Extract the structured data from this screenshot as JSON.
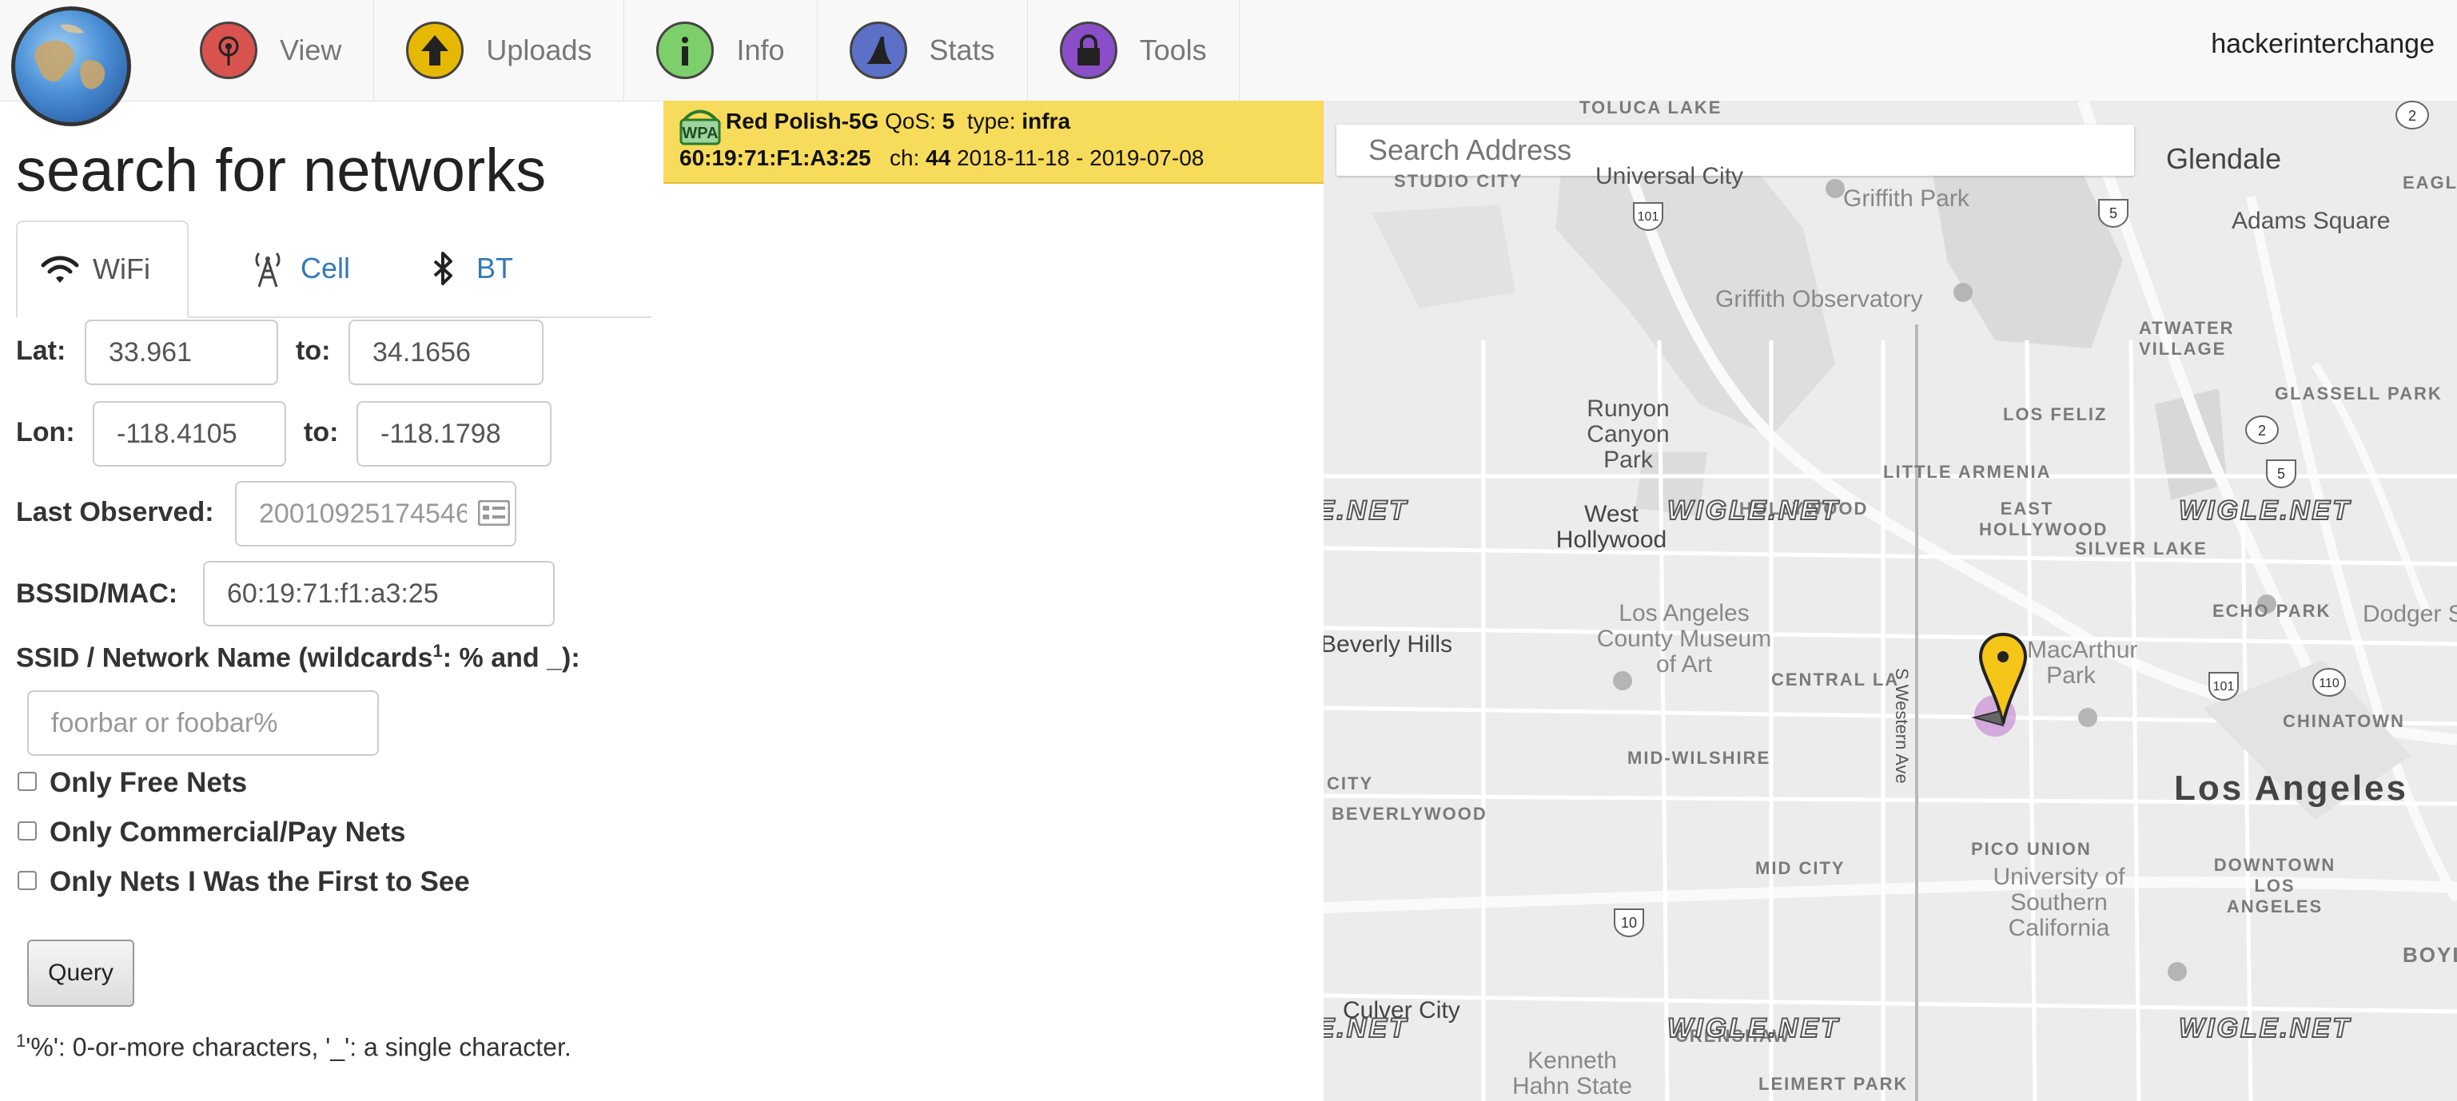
{
  "nav": {
    "items": [
      {
        "label": "View",
        "icon": "view-icon",
        "color": "#d9534f"
      },
      {
        "label": "Uploads",
        "icon": "upload-arrow-icon",
        "color": "#e6b800"
      },
      {
        "label": "Info",
        "icon": "info-icon",
        "color": "#5cb85c"
      },
      {
        "label": "Stats",
        "icon": "stats-icon",
        "color": "#4a5fb5"
      },
      {
        "label": "Tools",
        "icon": "lock-icon",
        "color": "#7b3fb5"
      }
    ],
    "username": "hackerinterchange"
  },
  "search": {
    "title": "search for networks",
    "tabs": [
      {
        "label": "WiFi",
        "icon": "wifi-icon",
        "active": true
      },
      {
        "label": "Cell",
        "icon": "cell-tower-icon",
        "active": false
      },
      {
        "label": "BT",
        "icon": "bluetooth-icon",
        "active": false
      }
    ],
    "lat_label": "Lat:",
    "lat_from": "33.961",
    "lat_to_label": "to:",
    "lat_to": "34.1656",
    "lon_label": "Lon:",
    "lon_from": "-118.4105",
    "lon_to_label": "to:",
    "lon_to": "-118.1798",
    "last_observed_label": "Last Observed:",
    "last_observed_placeholder": "20010925174546",
    "bssid_label": "BSSID/MAC:",
    "bssid_value": "60:19:71:f1:a3:25",
    "ssid_label_pre": "SSID / Network Name (wildcards",
    "ssid_label_sup": "1",
    "ssid_label_post": ": % and _):",
    "ssid_placeholder": "foorbar or foobar%",
    "checkboxes": [
      {
        "label": "Only Free Nets",
        "checked": false
      },
      {
        "label": "Only Commercial/Pay Nets",
        "checked": false
      },
      {
        "label": "Only Nets I Was the First to See",
        "checked": false
      }
    ],
    "query_label": "Query",
    "footnote_sup": "1",
    "footnote_text": "'%': 0-or-more characters, '_': a single character."
  },
  "result": {
    "icon": "wifi-infra-icon",
    "icon_text": "WPA",
    "ssid": "Red Polish-5G",
    "qos_label": "QoS:",
    "qos": "5",
    "type_label": "type:",
    "type": "infra",
    "bssid": "60:19:71:F1:A3:25",
    "channel_label": "ch:",
    "channel": "44",
    "dates": "2018-11-18 - 2019-07-08",
    "background": "#f7db5a"
  },
  "map": {
    "search_placeholder": "Search Address",
    "watermark": "WIGLE.NET",
    "marker_color": "#f5c518",
    "labels": {
      "toluca_lake": "TOLUCA LAKE",
      "glendale": "Glendale",
      "eagle": "EAGL",
      "studio_city": "STUDIO CITY",
      "universal_city": "Universal City",
      "griffith_park": "Griffith Park",
      "adams_square": "Adams Square",
      "griffith_observatory": "Griffith Observatory",
      "atwater_village": "ATWATER VILLAGE",
      "glassell_park": "GLASSELL PARK",
      "runyon": "Runyon Canyon Park",
      "los_feliz": "LOS FELIZ",
      "little_armenia": "LITTLE ARMENIA",
      "west_hollywood": "West Hollywood",
      "hollywood": "HOLLYWOOD",
      "east_hollywood": "EAST HOLLYWOOD",
      "silver_lake": "SILVER LAKE",
      "lacma": "Los Angeles County Museum of Art",
      "echo_park": "ECHO PARK",
      "dodger": "Dodger St",
      "beverly_hills": "Beverly Hills",
      "macarthur_park": "MacArthur Park",
      "central_la": "CENTRAL LA",
      "chinatown": "CHINATOWN",
      "western_ave": "S Western Ave",
      "mid_wilshire": "MID-WILSHIRE",
      "los_angeles": "Los Angeles",
      "city": "CITY",
      "beverlywood": "BEVERLYWOOD",
      "pico_union": "PICO UNION",
      "usc": "University of Southern California",
      "downtown": "DOWNTOWN LOS ANGELES",
      "mid_city": "MID CITY",
      "boyle": "BOYL",
      "culver_city": "Culver City",
      "crenshaw": "CRENSHAW",
      "kenneth_hahn": "Kenneth Hahn State",
      "leimert_park": "LEIMERT PARK"
    },
    "shields": [
      "2",
      "101",
      "5",
      "2",
      "5",
      "101",
      "110",
      "10"
    ]
  }
}
